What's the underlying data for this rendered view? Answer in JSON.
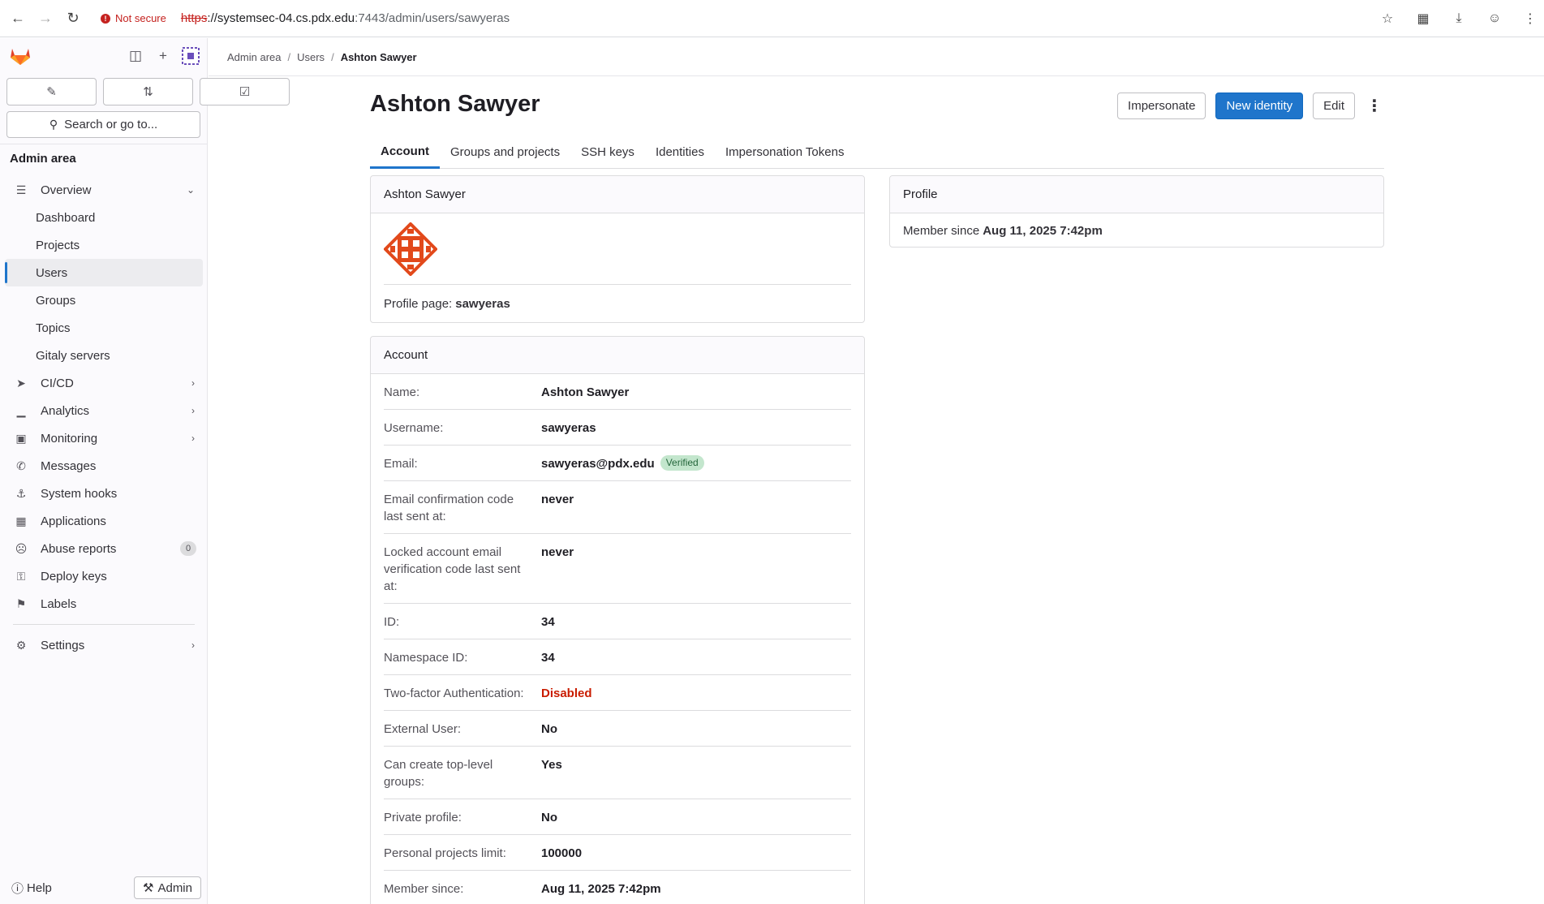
{
  "browser": {
    "security_label": "Not secure",
    "url_scheme": "https",
    "url_host": "://systemsec-04.cs.pdx.edu",
    "url_path": ":7443/admin/users/sawyeras"
  },
  "sidebar": {
    "search_label": "Search or go to...",
    "section_title": "Admin area",
    "items": [
      {
        "label": "Overview",
        "icon": "overview-icon"
      },
      {
        "label": "Dashboard"
      },
      {
        "label": "Projects"
      },
      {
        "label": "Users"
      },
      {
        "label": "Groups"
      },
      {
        "label": "Topics"
      },
      {
        "label": "Gitaly servers"
      },
      {
        "label": "CI/CD",
        "icon": "rocket-icon"
      },
      {
        "label": "Analytics",
        "icon": "chart-icon"
      },
      {
        "label": "Monitoring",
        "icon": "monitor-icon"
      },
      {
        "label": "Messages",
        "icon": "bullhorn-icon"
      },
      {
        "label": "System hooks",
        "icon": "anchor-icon"
      },
      {
        "label": "Applications",
        "icon": "grid-icon"
      },
      {
        "label": "Abuse reports",
        "icon": "abuse-icon",
        "count": "0"
      },
      {
        "label": "Deploy keys",
        "icon": "key-icon"
      },
      {
        "label": "Labels",
        "icon": "label-icon"
      },
      {
        "label": "Settings",
        "icon": "gear-icon"
      }
    ],
    "help_label": "Help",
    "admin_label": "Admin"
  },
  "breadcrumb": [
    "Admin area",
    "Users",
    "Ashton Sawyer"
  ],
  "page": {
    "title": "Ashton Sawyer",
    "actions": {
      "impersonate": "Impersonate",
      "new_identity": "New identity",
      "edit": "Edit"
    },
    "tabs": [
      "Account",
      "Groups and projects",
      "SSH keys",
      "Identities",
      "Impersonation Tokens"
    ],
    "active_tab": "Account"
  },
  "user_card": {
    "header": "Ashton Sawyer",
    "profile_page_label": "Profile page:",
    "profile_page_value": "sawyeras"
  },
  "account_card": {
    "header": "Account",
    "rows": [
      {
        "label": "Name:",
        "value": "Ashton Sawyer"
      },
      {
        "label": "Username:",
        "value": "sawyeras"
      },
      {
        "label": "Email:",
        "value": "sawyeras@pdx.edu",
        "badge": "Verified"
      },
      {
        "label": "Email confirmation code last sent at:",
        "value": "never"
      },
      {
        "label": "Locked account email verification code last sent at:",
        "value": "never"
      },
      {
        "label": "ID:",
        "value": "34"
      },
      {
        "label": "Namespace ID:",
        "value": "34"
      },
      {
        "label": "Two-factor Authentication:",
        "value": "Disabled"
      },
      {
        "label": "External User:",
        "value": "No"
      },
      {
        "label": "Can create top-level groups:",
        "value": "Yes"
      },
      {
        "label": "Private profile:",
        "value": "No"
      },
      {
        "label": "Personal projects limit:",
        "value": "100000"
      },
      {
        "label": "Member since:",
        "value": "Aug 11, 2025 7:42pm"
      }
    ]
  },
  "profile_card": {
    "header": "Profile",
    "member_since_label": "Member since",
    "member_since_value": "Aug 11, 2025 7:42pm"
  },
  "colors": {
    "accent": "#1f75cb",
    "danger": "#c91c00",
    "brand": "#e24329"
  }
}
